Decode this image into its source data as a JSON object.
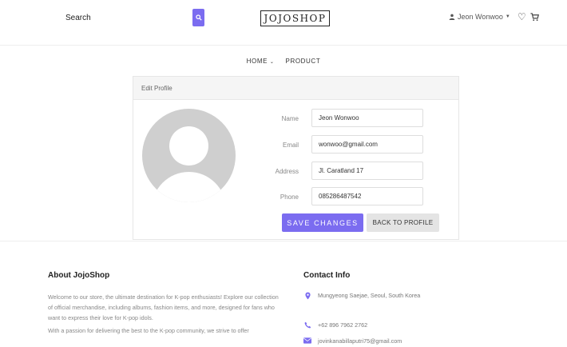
{
  "header": {
    "search_label": "Search",
    "logo": "JOJOSHOP",
    "user_name": "Jeon Wonwoo",
    "icons": [
      "search-icon",
      "user-icon",
      "caret-down-icon",
      "heart-icon",
      "cart-icon"
    ]
  },
  "nav": {
    "home": "HOME",
    "product": "PRODUCT"
  },
  "profile_card": {
    "title": "Edit Profile",
    "fields": {
      "name_label": "Name",
      "name_value": "Jeon Wonwoo",
      "email_label": "Email",
      "email_value": "wonwoo@gmail.com",
      "address_label": "Address",
      "address_value": "Jl. Caratland 17",
      "phone_label": "Phone",
      "phone_value": "085286487542"
    },
    "save_label": "SAVE CHANGES",
    "back_label": "BACK TO PROFILE"
  },
  "footer": {
    "about_title": "About JojoShop",
    "about_p1": "Welcome to our store, the ultimate destination for K-pop enthusiasts! Explore our collection of official merchandise, including albums, fashion items, and more, designed for fans who want to express their love for K-pop idols.",
    "about_p2": "With a passion for delivering the best to the K-pop community, we strive to offer",
    "contact_title": "Contact Info",
    "address": "Mungyeong Saejae, Seoul, South Korea",
    "phone": "+62 896 7962 2762",
    "email": "jovinkanabillaputri75@gmail.com"
  },
  "colors": {
    "accent": "#7b6cf0",
    "avatar_gray": "#cfcfcf"
  }
}
